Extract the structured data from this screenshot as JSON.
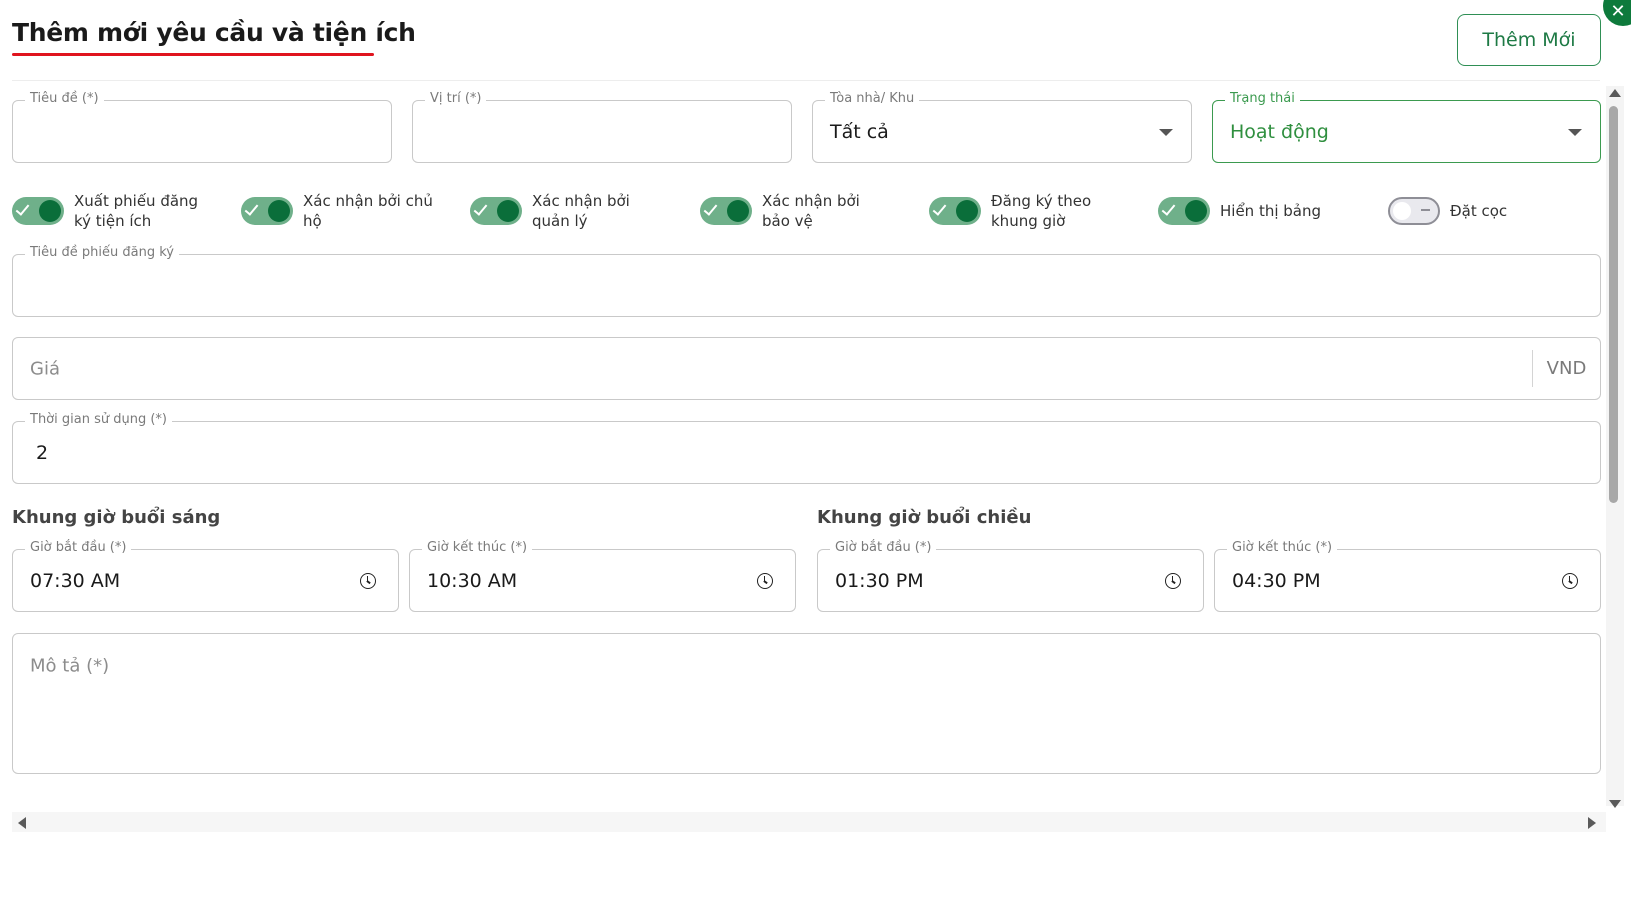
{
  "dialog": {
    "title": "Thêm mới yêu cầu và tiện ích",
    "add_button_label": "Thêm Mới",
    "close_icon": "close-icon",
    "close_glyph": "✕"
  },
  "fields": {
    "title_label": "Tiêu đề (*)",
    "title_value": "",
    "location_label": "Vị trí (*)",
    "location_value": "",
    "building_label": "Tòa nhà/ Khu",
    "building_value": "Tất cả",
    "status_label": "Trạng thái",
    "status_value": "Hoạt động",
    "form_title_label": "Tiêu đề phiếu đăng ký",
    "form_title_value": "",
    "price_placeholder": "Giá",
    "price_suffix": "VND",
    "usage_time_label": "Thời gian sử dụng (*)",
    "usage_time_value": "2",
    "description_placeholder": "Mô tả (*)"
  },
  "toggles": [
    {
      "label": "Xuất phiếu đăng ký tiện ích",
      "on": true
    },
    {
      "label": "Xác nhận bởi chủ hộ",
      "on": true
    },
    {
      "label": "Xác nhận bởi quản lý",
      "on": true
    },
    {
      "label": "Xác nhận bởi bảo vệ",
      "on": true
    },
    {
      "label": "Đăng ký theo khung giờ",
      "on": true
    },
    {
      "label": "Hiển thị bảng",
      "on": true
    },
    {
      "label": "Đặt cọc",
      "on": false
    }
  ],
  "morning": {
    "title": "Khung giờ buổi sáng",
    "start_label": "Giờ bắt đầu (*)",
    "start_value": "07:30 AM",
    "end_label": "Giờ kết thúc (*)",
    "end_value": "10:30 AM"
  },
  "afternoon": {
    "title": "Khung giờ buổi chiều",
    "start_label": "Giờ bắt đầu (*)",
    "start_value": "01:30 PM",
    "end_label": "Giờ kết thúc (*)",
    "end_value": "04:30 PM"
  },
  "colors": {
    "accent": "#0a6e3a",
    "title_underline": "#e0141e",
    "active_border": "#3b9a4f"
  }
}
